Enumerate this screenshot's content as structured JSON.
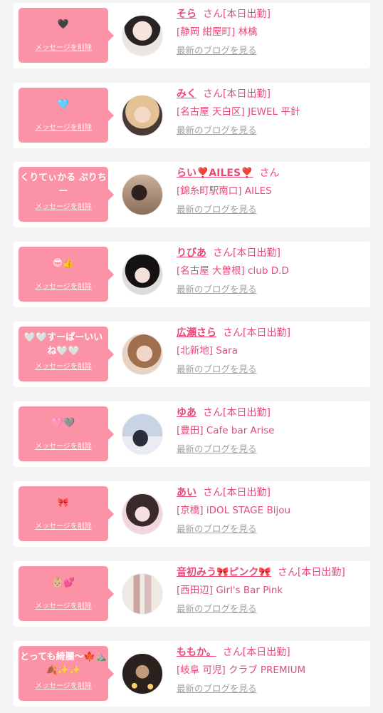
{
  "cards": [
    {
      "message": "🖤",
      "delete_label": "メッセージを削除",
      "name": "そら",
      "san": "さん[本日出勤]",
      "shop": "[静岡 紺屋町] 林檎",
      "blog": "最新のブログを見る"
    },
    {
      "message": "🩵",
      "delete_label": "メッセージを削除",
      "name": "みく",
      "san": "さん[本日出勤]",
      "shop": "[名古屋 天白区] JEWEL 平針",
      "blog": "最新のブログを見る"
    },
    {
      "message": "くりてぃかる ぷりちー",
      "delete_label": "メッセージを削除",
      "name": "らい❣️AILES❣️",
      "san": "さん",
      "shop": "[錦糸町駅南口] AILES",
      "blog": "最新のブログを見る"
    },
    {
      "message": "😎👍",
      "delete_label": "メッセージを削除",
      "name": "りびあ",
      "san": "さん[本日出勤]",
      "shop": "[名古屋 大曽根] club D.D",
      "blog": "最新のブログを見る"
    },
    {
      "message": "🤍🤍すーぱーいいね🤍🤍",
      "delete_label": "メッセージを削除",
      "name": "広瀬さら",
      "san": "さん[本日出勤]",
      "shop": "[北新地] Sara",
      "blog": "最新のブログを見る"
    },
    {
      "message": "🩷🩶",
      "delete_label": "メッセージを削除",
      "name": "ゆあ",
      "san": "さん[本日出勤]",
      "shop": "[豊田] Cafe bar Arise",
      "blog": "最新のブログを見る"
    },
    {
      "message": "🎀",
      "delete_label": "メッセージを削除",
      "name": "あい",
      "san": "さん[本日出勤]",
      "shop": "[京橋] iDOL STAGE Bijou",
      "blog": "最新のブログを見る"
    },
    {
      "message": "👶🏼💕",
      "delete_label": "メッセージを削除",
      "name": "音初みう🎀ピンク🎀",
      "san": "さん[本日出勤]",
      "shop": "[西田辺] Girl's Bar Pink",
      "blog": "最新のブログを見る"
    },
    {
      "message": "とっても綺麗〜🍁⛰️🍂✨✨",
      "delete_label": "メッセージを削除",
      "name": "ももか。",
      "san": "さん[本日出勤]",
      "shop": "[岐阜 可児] クラブ PREMIUM",
      "blog": "最新のブログを見る"
    }
  ]
}
